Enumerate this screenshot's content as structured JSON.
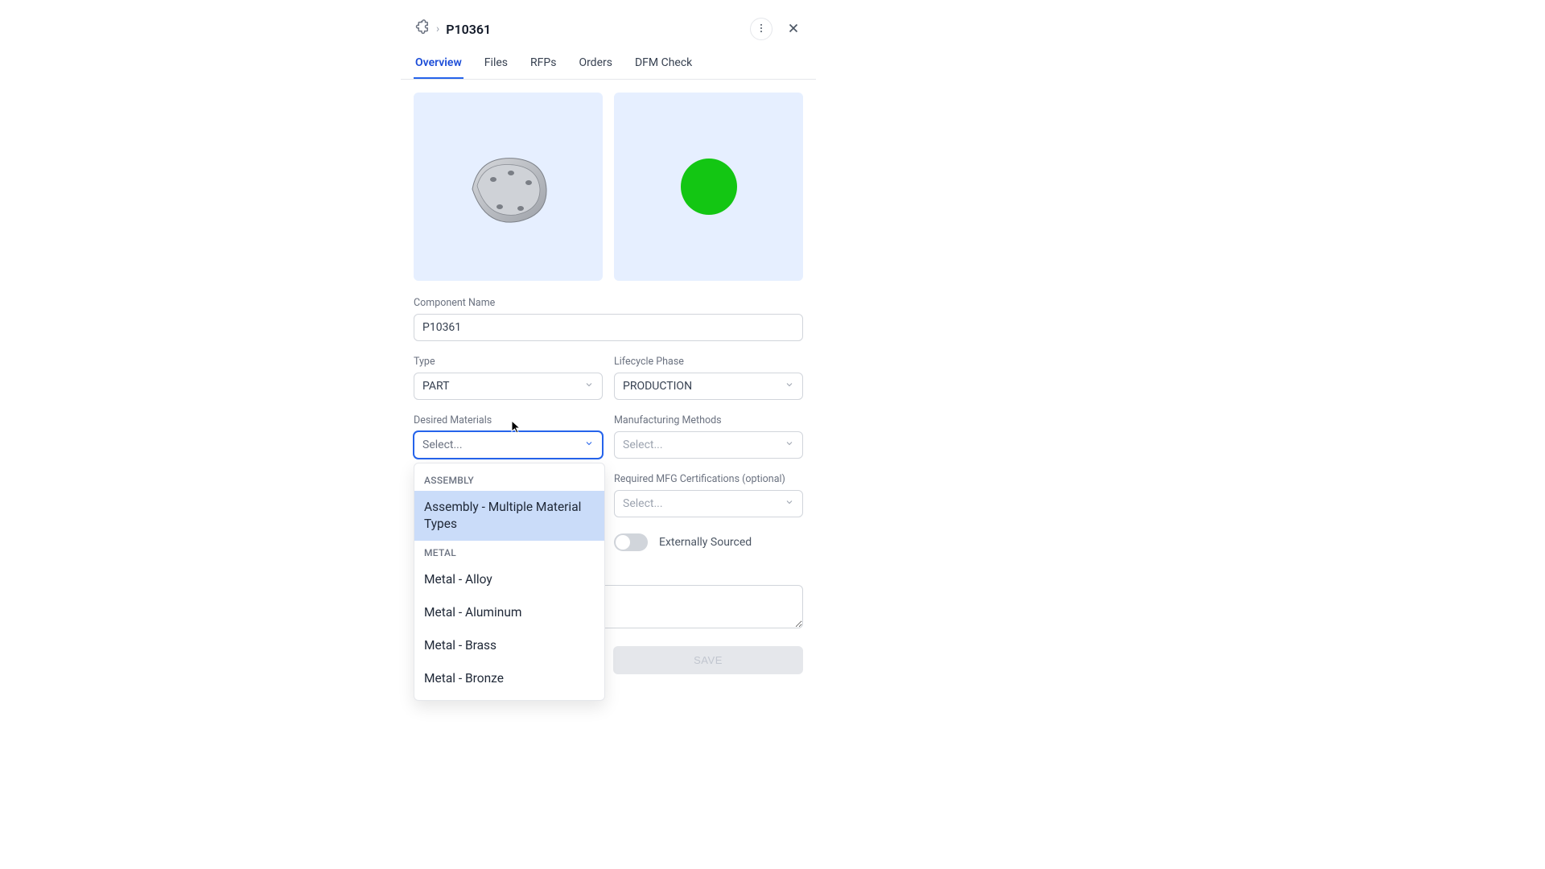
{
  "header": {
    "title": "P10361"
  },
  "tabs": [
    {
      "label": "Overview",
      "active": true
    },
    {
      "label": "Files"
    },
    {
      "label": "RFPs"
    },
    {
      "label": "Orders"
    },
    {
      "label": "DFM Check"
    }
  ],
  "form": {
    "component_name_label": "Component Name",
    "component_name_value": "P10361",
    "type_label": "Type",
    "type_value": "PART",
    "lifecycle_label": "Lifecycle Phase",
    "lifecycle_value": "PRODUCTION",
    "materials_label": "Desired Materials",
    "materials_placeholder": "Select...",
    "methods_label": "Manufacturing Methods",
    "methods_placeholder": "Select...",
    "certs_label": "Required MFG Certifications (optional)",
    "certs_placeholder": "Select...",
    "externally_sourced_label": "Externally Sourced",
    "save_label": "SAVE"
  },
  "materials_dropdown": {
    "groups": [
      {
        "label": "ASSEMBLY",
        "options": [
          {
            "label": "Assembly - Multiple Material Types",
            "highlight": true
          }
        ]
      },
      {
        "label": "METAL",
        "options": [
          {
            "label": "Metal - Alloy"
          },
          {
            "label": "Metal - Aluminum"
          },
          {
            "label": "Metal - Brass"
          },
          {
            "label": "Metal - Bronze"
          }
        ]
      }
    ]
  }
}
